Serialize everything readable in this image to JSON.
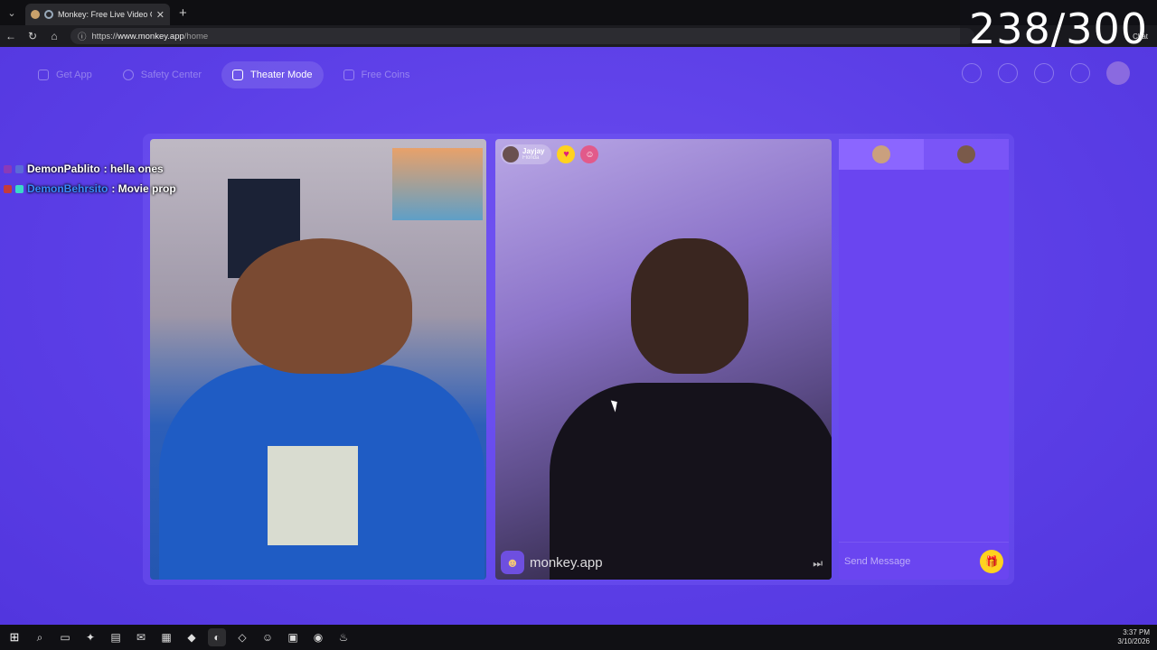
{
  "browser": {
    "tab_title": "Monkey: Free Live Video Chat",
    "url_scheme": "https://",
    "url_host": "www.monkey.app",
    "url_path": "/home",
    "chat_label": "Chat"
  },
  "overlay": {
    "counter": "238/300",
    "chat_lines": [
      {
        "user": "DemonPablito",
        "message": " : hella ones"
      },
      {
        "user": "DemonBehrsito",
        "message": " : Movie prop"
      }
    ]
  },
  "topnav": {
    "get_app": "Get App",
    "safety_center": "Safety Center",
    "theater_mode": "Theater Mode",
    "free_coins": "Free Coins"
  },
  "partner": {
    "name": "Jayjay",
    "location": "Florida"
  },
  "watermark": "monkey.app",
  "sidebar": {
    "message_placeholder": "Send Message"
  },
  "taskbar": {
    "time": "3:37 PM",
    "date": "3/10/2026"
  },
  "colors": {
    "background": "#5b3ee6",
    "panel": "#6a45f0",
    "accent_gold": "#ffd21f"
  }
}
